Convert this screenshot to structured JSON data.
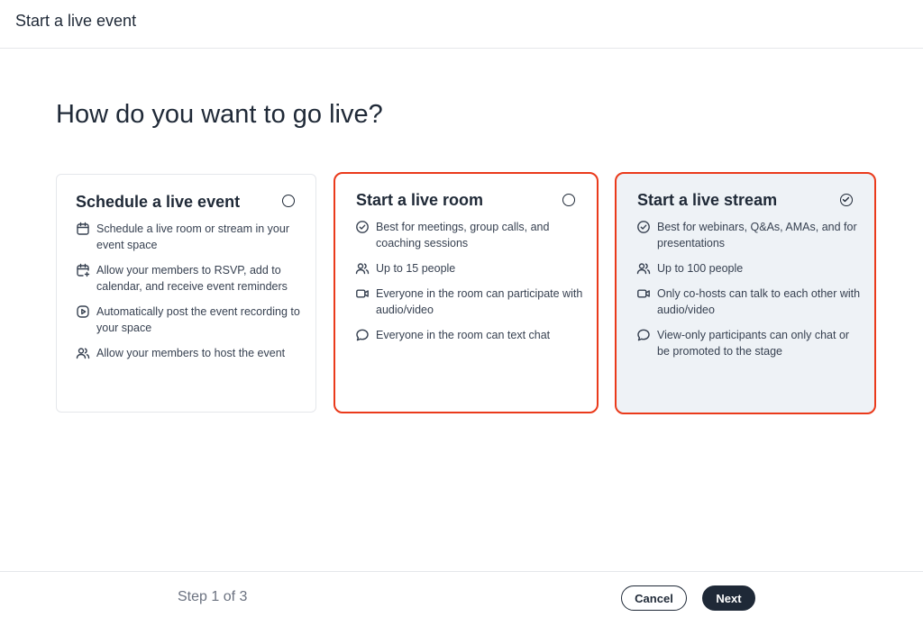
{
  "header": {
    "title": "Start a live event"
  },
  "heading": "How do you want to go live?",
  "cards": [
    {
      "title": "Schedule a live event",
      "selected": false,
      "features": [
        {
          "icon": "calendar-icon",
          "text": "Schedule a live room or stream in your event space"
        },
        {
          "icon": "calendar-plus-icon",
          "text": "Allow your members to RSVP, add to calendar, and receive event reminders"
        },
        {
          "icon": "play-icon",
          "text": "Automatically post the event recording to your space"
        },
        {
          "icon": "users-icon",
          "text": "Allow your members to host the event"
        }
      ]
    },
    {
      "title": "Start a live room",
      "selected": false,
      "features": [
        {
          "icon": "check-circle-icon",
          "text": "Best for meetings, group calls, and coaching sessions"
        },
        {
          "icon": "users-icon",
          "text": "Up to 15 people"
        },
        {
          "icon": "video-icon",
          "text": "Everyone in the room can participate with audio/video"
        },
        {
          "icon": "chat-icon",
          "text": "Everyone in the room can text chat"
        }
      ]
    },
    {
      "title": "Start a live stream",
      "selected": true,
      "features": [
        {
          "icon": "check-circle-icon",
          "text": "Best for webinars, Q&As, AMAs, and for presentations"
        },
        {
          "icon": "users-icon",
          "text": "Up to 100 people"
        },
        {
          "icon": "video-icon",
          "text": "Only co-hosts can talk to each other with audio/video"
        },
        {
          "icon": "chat-icon",
          "text": "View-only participants can only chat or be promoted to the stage"
        }
      ]
    }
  ],
  "footer": {
    "step_label": "Step 1 of 3",
    "cancel_label": "Cancel",
    "next_label": "Next"
  },
  "colors": {
    "highlight_border": "#ea3a1b",
    "selected_bg": "#eef2f6",
    "primary": "#1f2937"
  }
}
